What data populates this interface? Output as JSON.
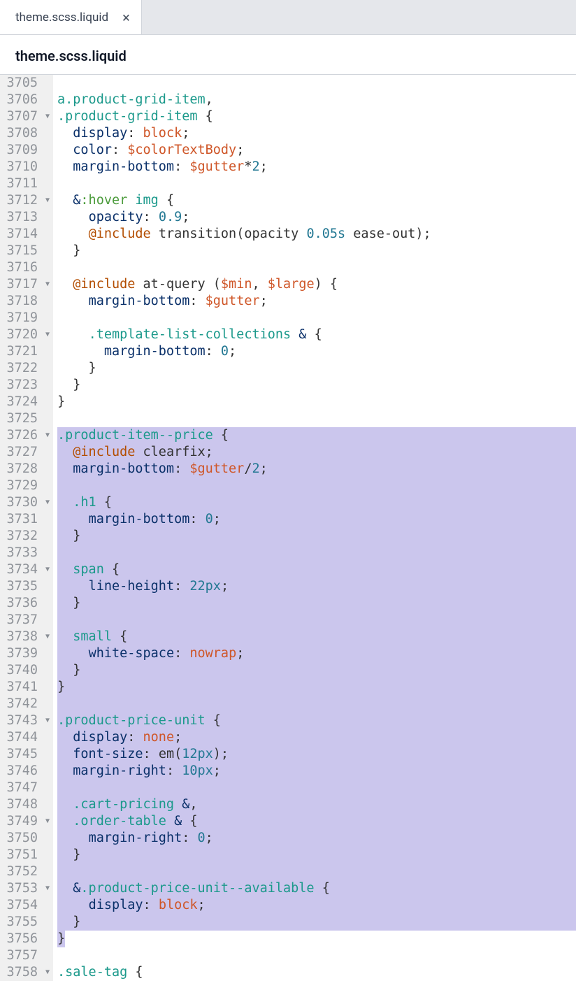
{
  "tab": {
    "label": "theme.scss.liquid",
    "close": "×"
  },
  "header": {
    "filename": "theme.scss.liquid"
  },
  "gutter": {
    "start": 3705,
    "end": 3758,
    "folds": [
      3707,
      3712,
      3717,
      3720,
      3726,
      3730,
      3734,
      3738,
      3743,
      3749,
      3753,
      3758
    ]
  },
  "code": {
    "lines": [
      {
        "n": 3705,
        "seg": []
      },
      {
        "n": 3706,
        "seg": [
          {
            "t": "a",
            "c": "tk-tag"
          },
          {
            "t": ".product-grid-item",
            "c": "tk-sel"
          },
          {
            "t": ",",
            "c": "tk-punct"
          }
        ]
      },
      {
        "n": 3707,
        "seg": [
          {
            "t": ".product-grid-item",
            "c": "tk-sel"
          },
          {
            "t": " {",
            "c": "tk-punct"
          }
        ]
      },
      {
        "n": 3708,
        "seg": [
          {
            "t": "  ",
            "c": ""
          },
          {
            "t": "display",
            "c": "tk-prop"
          },
          {
            "t": ": ",
            "c": "tk-punct"
          },
          {
            "t": "block",
            "c": "tk-val"
          },
          {
            "t": ";",
            "c": "tk-punct"
          }
        ]
      },
      {
        "n": 3709,
        "seg": [
          {
            "t": "  ",
            "c": ""
          },
          {
            "t": "color",
            "c": "tk-prop"
          },
          {
            "t": ": ",
            "c": "tk-punct"
          },
          {
            "t": "$colorTextBody",
            "c": "tk-var"
          },
          {
            "t": ";",
            "c": "tk-punct"
          }
        ]
      },
      {
        "n": 3710,
        "seg": [
          {
            "t": "  ",
            "c": ""
          },
          {
            "t": "margin-bottom",
            "c": "tk-prop"
          },
          {
            "t": ": ",
            "c": "tk-punct"
          },
          {
            "t": "$gutter",
            "c": "tk-var"
          },
          {
            "t": "*",
            "c": "tk-punct"
          },
          {
            "t": "2",
            "c": "tk-num"
          },
          {
            "t": ";",
            "c": "tk-punct"
          }
        ]
      },
      {
        "n": 3711,
        "seg": []
      },
      {
        "n": 3712,
        "seg": [
          {
            "t": "  ",
            "c": ""
          },
          {
            "t": "&",
            "c": "tk-amp"
          },
          {
            "t": ":hover",
            "c": "tk-pseudo"
          },
          {
            "t": " ",
            "c": ""
          },
          {
            "t": "img",
            "c": "tk-tag"
          },
          {
            "t": " {",
            "c": "tk-punct"
          }
        ]
      },
      {
        "n": 3713,
        "seg": [
          {
            "t": "    ",
            "c": ""
          },
          {
            "t": "opacity",
            "c": "tk-prop"
          },
          {
            "t": ": ",
            "c": "tk-punct"
          },
          {
            "t": "0.9",
            "c": "tk-num"
          },
          {
            "t": ";",
            "c": "tk-punct"
          }
        ]
      },
      {
        "n": 3714,
        "seg": [
          {
            "t": "    ",
            "c": ""
          },
          {
            "t": "@include",
            "c": "tk-at"
          },
          {
            "t": " ",
            "c": ""
          },
          {
            "t": "transition",
            "c": "tk-fn"
          },
          {
            "t": "(",
            "c": "tk-punct"
          },
          {
            "t": "opacity ",
            "c": "tk-txt"
          },
          {
            "t": "0.05s",
            "c": "tk-num"
          },
          {
            "t": " ease-out",
            "c": "tk-txt"
          },
          {
            "t": ");",
            "c": "tk-punct"
          }
        ]
      },
      {
        "n": 3715,
        "seg": [
          {
            "t": "  }",
            "c": "tk-punct"
          }
        ]
      },
      {
        "n": 3716,
        "seg": []
      },
      {
        "n": 3717,
        "seg": [
          {
            "t": "  ",
            "c": ""
          },
          {
            "t": "@include",
            "c": "tk-at"
          },
          {
            "t": " at-query ",
            "c": "tk-fn"
          },
          {
            "t": "(",
            "c": "tk-punct"
          },
          {
            "t": "$min",
            "c": "tk-var"
          },
          {
            "t": ", ",
            "c": "tk-punct"
          },
          {
            "t": "$large",
            "c": "tk-var"
          },
          {
            "t": ") {",
            "c": "tk-punct"
          }
        ]
      },
      {
        "n": 3718,
        "seg": [
          {
            "t": "    ",
            "c": ""
          },
          {
            "t": "margin-bottom",
            "c": "tk-prop"
          },
          {
            "t": ": ",
            "c": "tk-punct"
          },
          {
            "t": "$gutter",
            "c": "tk-var"
          },
          {
            "t": ";",
            "c": "tk-punct"
          }
        ]
      },
      {
        "n": 3719,
        "seg": []
      },
      {
        "n": 3720,
        "seg": [
          {
            "t": "    ",
            "c": ""
          },
          {
            "t": ".template-list-collections",
            "c": "tk-sel"
          },
          {
            "t": " ",
            "c": ""
          },
          {
            "t": "&",
            "c": "tk-amp"
          },
          {
            "t": " {",
            "c": "tk-punct"
          }
        ]
      },
      {
        "n": 3721,
        "seg": [
          {
            "t": "      ",
            "c": ""
          },
          {
            "t": "margin-bottom",
            "c": "tk-prop"
          },
          {
            "t": ": ",
            "c": "tk-punct"
          },
          {
            "t": "0",
            "c": "tk-num"
          },
          {
            "t": ";",
            "c": "tk-punct"
          }
        ]
      },
      {
        "n": 3722,
        "seg": [
          {
            "t": "    }",
            "c": "tk-punct"
          }
        ]
      },
      {
        "n": 3723,
        "seg": [
          {
            "t": "  }",
            "c": "tk-punct"
          }
        ]
      },
      {
        "n": 3724,
        "seg": [
          {
            "t": "}",
            "c": "tk-punct"
          }
        ]
      },
      {
        "n": 3725,
        "seg": []
      },
      {
        "n": 3726,
        "hl": true,
        "seg": [
          {
            "t": ".product-item--price",
            "c": "tk-sel"
          },
          {
            "t": " {",
            "c": "tk-punct"
          }
        ]
      },
      {
        "n": 3727,
        "hl": true,
        "seg": [
          {
            "t": "  ",
            "c": ""
          },
          {
            "t": "@include",
            "c": "tk-at"
          },
          {
            "t": " clearfix",
            "c": "tk-fn"
          },
          {
            "t": ";",
            "c": "tk-punct"
          }
        ]
      },
      {
        "n": 3728,
        "hl": true,
        "seg": [
          {
            "t": "  ",
            "c": ""
          },
          {
            "t": "margin-bottom",
            "c": "tk-prop"
          },
          {
            "t": ": ",
            "c": "tk-punct"
          },
          {
            "t": "$gutter",
            "c": "tk-var"
          },
          {
            "t": "/",
            "c": "tk-punct"
          },
          {
            "t": "2",
            "c": "tk-num"
          },
          {
            "t": ";",
            "c": "tk-punct"
          }
        ]
      },
      {
        "n": 3729,
        "hl": true,
        "seg": []
      },
      {
        "n": 3730,
        "hl": true,
        "seg": [
          {
            "t": "  ",
            "c": ""
          },
          {
            "t": ".h1",
            "c": "tk-sel"
          },
          {
            "t": " {",
            "c": "tk-punct"
          }
        ]
      },
      {
        "n": 3731,
        "hl": true,
        "seg": [
          {
            "t": "    ",
            "c": ""
          },
          {
            "t": "margin-bottom",
            "c": "tk-prop"
          },
          {
            "t": ": ",
            "c": "tk-punct"
          },
          {
            "t": "0",
            "c": "tk-num"
          },
          {
            "t": ";",
            "c": "tk-punct"
          }
        ]
      },
      {
        "n": 3732,
        "hl": true,
        "seg": [
          {
            "t": "  }",
            "c": "tk-punct"
          }
        ]
      },
      {
        "n": 3733,
        "hl": true,
        "seg": []
      },
      {
        "n": 3734,
        "hl": true,
        "seg": [
          {
            "t": "  ",
            "c": ""
          },
          {
            "t": "span",
            "c": "tk-tag"
          },
          {
            "t": " {",
            "c": "tk-punct"
          }
        ]
      },
      {
        "n": 3735,
        "hl": true,
        "seg": [
          {
            "t": "    ",
            "c": ""
          },
          {
            "t": "line-height",
            "c": "tk-prop"
          },
          {
            "t": ": ",
            "c": "tk-punct"
          },
          {
            "t": "22px",
            "c": "tk-num"
          },
          {
            "t": ";",
            "c": "tk-punct"
          }
        ]
      },
      {
        "n": 3736,
        "hl": true,
        "seg": [
          {
            "t": "  }",
            "c": "tk-punct"
          }
        ]
      },
      {
        "n": 3737,
        "hl": true,
        "seg": []
      },
      {
        "n": 3738,
        "hl": true,
        "seg": [
          {
            "t": "  ",
            "c": ""
          },
          {
            "t": "small",
            "c": "tk-tag"
          },
          {
            "t": " {",
            "c": "tk-punct"
          }
        ]
      },
      {
        "n": 3739,
        "hl": true,
        "seg": [
          {
            "t": "    ",
            "c": ""
          },
          {
            "t": "white-space",
            "c": "tk-prop"
          },
          {
            "t": ": ",
            "c": "tk-punct"
          },
          {
            "t": "nowrap",
            "c": "tk-val"
          },
          {
            "t": ";",
            "c": "tk-punct"
          }
        ]
      },
      {
        "n": 3740,
        "hl": true,
        "seg": [
          {
            "t": "  }",
            "c": "tk-punct"
          }
        ]
      },
      {
        "n": 3741,
        "hl": true,
        "seg": [
          {
            "t": "}",
            "c": "tk-punct"
          }
        ]
      },
      {
        "n": 3742,
        "hl": true,
        "seg": []
      },
      {
        "n": 3743,
        "hl": true,
        "seg": [
          {
            "t": ".product-price-unit",
            "c": "tk-sel"
          },
          {
            "t": " {",
            "c": "tk-punct"
          }
        ]
      },
      {
        "n": 3744,
        "hl": true,
        "seg": [
          {
            "t": "  ",
            "c": ""
          },
          {
            "t": "display",
            "c": "tk-prop"
          },
          {
            "t": ": ",
            "c": "tk-punct"
          },
          {
            "t": "none",
            "c": "tk-val"
          },
          {
            "t": ";",
            "c": "tk-punct"
          }
        ]
      },
      {
        "n": 3745,
        "hl": true,
        "seg": [
          {
            "t": "  ",
            "c": ""
          },
          {
            "t": "font-size",
            "c": "tk-prop"
          },
          {
            "t": ": ",
            "c": "tk-punct"
          },
          {
            "t": "em",
            "c": "tk-fn"
          },
          {
            "t": "(",
            "c": "tk-punct"
          },
          {
            "t": "12px",
            "c": "tk-num"
          },
          {
            "t": ");",
            "c": "tk-punct"
          }
        ]
      },
      {
        "n": 3746,
        "hl": true,
        "seg": [
          {
            "t": "  ",
            "c": ""
          },
          {
            "t": "margin-right",
            "c": "tk-prop"
          },
          {
            "t": ": ",
            "c": "tk-punct"
          },
          {
            "t": "10px",
            "c": "tk-num"
          },
          {
            "t": ";",
            "c": "tk-punct"
          }
        ]
      },
      {
        "n": 3747,
        "hl": true,
        "seg": []
      },
      {
        "n": 3748,
        "hl": true,
        "seg": [
          {
            "t": "  ",
            "c": ""
          },
          {
            "t": ".cart-pricing",
            "c": "tk-sel"
          },
          {
            "t": " ",
            "c": ""
          },
          {
            "t": "&",
            "c": "tk-amp"
          },
          {
            "t": ",",
            "c": "tk-punct"
          }
        ]
      },
      {
        "n": 3749,
        "hl": true,
        "seg": [
          {
            "t": "  ",
            "c": ""
          },
          {
            "t": ".order-table",
            "c": "tk-sel"
          },
          {
            "t": " ",
            "c": ""
          },
          {
            "t": "&",
            "c": "tk-amp"
          },
          {
            "t": " {",
            "c": "tk-punct"
          }
        ]
      },
      {
        "n": 3750,
        "hl": true,
        "seg": [
          {
            "t": "    ",
            "c": ""
          },
          {
            "t": "margin-right",
            "c": "tk-prop"
          },
          {
            "t": ": ",
            "c": "tk-punct"
          },
          {
            "t": "0",
            "c": "tk-num"
          },
          {
            "t": ";",
            "c": "tk-punct"
          }
        ]
      },
      {
        "n": 3751,
        "hl": true,
        "seg": [
          {
            "t": "  }",
            "c": "tk-punct"
          }
        ]
      },
      {
        "n": 3752,
        "hl": true,
        "seg": []
      },
      {
        "n": 3753,
        "hl": true,
        "seg": [
          {
            "t": "  ",
            "c": ""
          },
          {
            "t": "&",
            "c": "tk-amp"
          },
          {
            "t": ".product-price-unit--available",
            "c": "tk-sel"
          },
          {
            "t": " {",
            "c": "tk-punct"
          }
        ]
      },
      {
        "n": 3754,
        "hl": true,
        "seg": [
          {
            "t": "    ",
            "c": ""
          },
          {
            "t": "display",
            "c": "tk-prop"
          },
          {
            "t": ": ",
            "c": "tk-punct"
          },
          {
            "t": "block",
            "c": "tk-val"
          },
          {
            "t": ";",
            "c": "tk-punct"
          }
        ]
      },
      {
        "n": 3755,
        "hl": true,
        "seg": [
          {
            "t": "  }",
            "c": "tk-punct"
          }
        ]
      },
      {
        "n": 3756,
        "hlshort": true,
        "seg": [
          {
            "t": "}",
            "c": "tk-punct"
          }
        ]
      },
      {
        "n": 3757,
        "seg": []
      },
      {
        "n": 3758,
        "seg": [
          {
            "t": ".sale-tag",
            "c": "tk-sel"
          },
          {
            "t": " {",
            "c": "tk-punct"
          }
        ]
      }
    ]
  }
}
